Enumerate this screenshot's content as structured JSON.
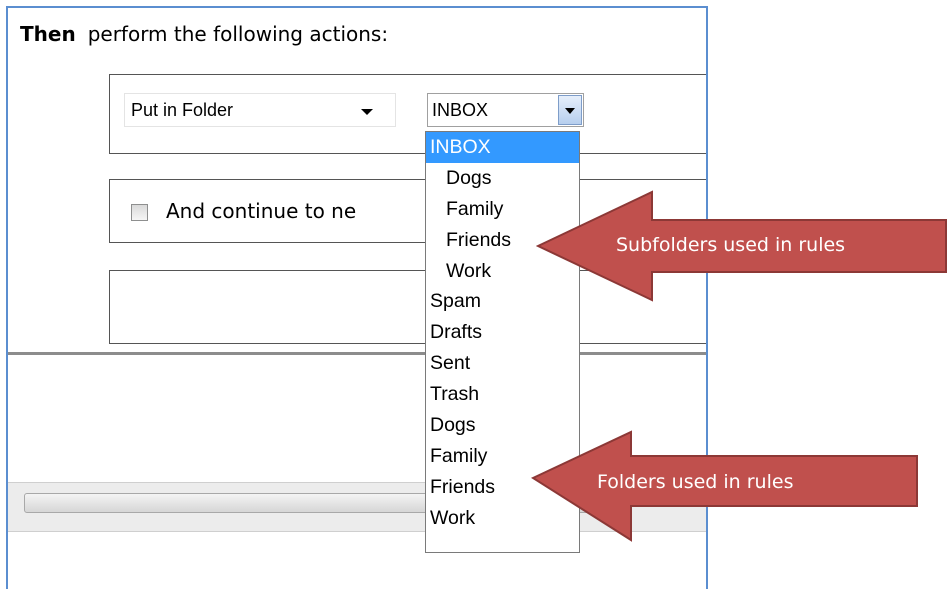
{
  "rule_actions": {
    "heading_keyword": "Then",
    "heading_text": "perform the following actions:",
    "action_select": {
      "value": "Put in Folder"
    },
    "folder_select": {
      "value": "INBOX"
    },
    "continue_checkbox": {
      "label": "And continue to ne",
      "checked": false
    }
  },
  "folder_dropdown": {
    "items": [
      {
        "label": "INBOX",
        "selected": true,
        "indent": false
      },
      {
        "label": "Dogs",
        "selected": false,
        "indent": true
      },
      {
        "label": "Family",
        "selected": false,
        "indent": true
      },
      {
        "label": "Friends",
        "selected": false,
        "indent": true
      },
      {
        "label": "Work",
        "selected": false,
        "indent": true
      },
      {
        "label": "Spam",
        "selected": false,
        "indent": false
      },
      {
        "label": "Drafts",
        "selected": false,
        "indent": false
      },
      {
        "label": "Sent",
        "selected": false,
        "indent": false
      },
      {
        "label": "Trash",
        "selected": false,
        "indent": false
      },
      {
        "label": "Dogs",
        "selected": false,
        "indent": false
      },
      {
        "label": "Family",
        "selected": false,
        "indent": false
      },
      {
        "label": "Friends",
        "selected": false,
        "indent": false
      },
      {
        "label": "Work",
        "selected": false,
        "indent": false
      }
    ]
  },
  "annotations": {
    "subfolders_callout": "Subfolders used in rules",
    "folders_callout": "Folders used in rules",
    "callout_fill": "#c0504d",
    "callout_stroke": "#8c3836"
  },
  "colors": {
    "window_border": "#5b8ed0",
    "selected_item": "#3399ff"
  }
}
